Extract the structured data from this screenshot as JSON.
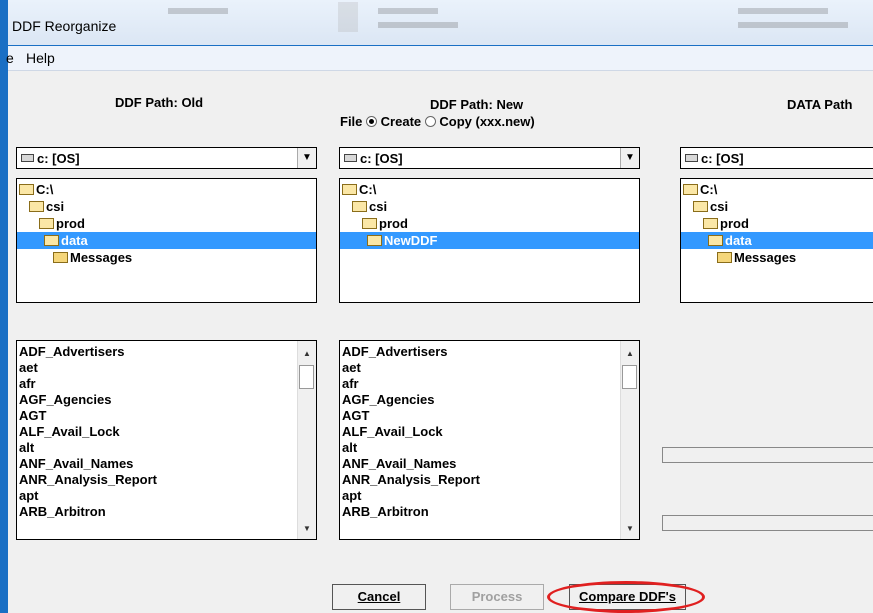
{
  "window": {
    "title": "DDF Reorganize"
  },
  "menu": {
    "items": [
      "e",
      "Help"
    ]
  },
  "columns": {
    "old": {
      "header": "DDF Path: Old",
      "drive": "c: [OS]",
      "tree": [
        "C:\\",
        "csi",
        "prod",
        "data",
        "Messages"
      ],
      "list": [
        "ADF_Advertisers",
        "aet",
        "afr",
        "AGF_Agencies",
        "AGT",
        "ALF_Avail_Lock",
        "alt",
        "ANF_Avail_Names",
        "ANR_Analysis_Report",
        "apt",
        "ARB_Arbitron"
      ]
    },
    "new": {
      "header": "DDF Path: New",
      "file_label": "File",
      "create_label": "Create",
      "copy_label": "Copy (xxx.new)",
      "selected_mode": "Create",
      "drive": "c: [OS]",
      "tree": [
        "C:\\",
        "csi",
        "prod",
        "NewDDF"
      ],
      "list": [
        "ADF_Advertisers",
        "aet",
        "afr",
        "AGF_Agencies",
        "AGT",
        "ALF_Avail_Lock",
        "alt",
        "ANF_Avail_Names",
        "ANR_Analysis_Report",
        "apt",
        "ARB_Arbitron"
      ]
    },
    "data": {
      "header": "DATA Path",
      "drive": "c: [OS]",
      "tree": [
        "C:\\",
        "csi",
        "prod",
        "data",
        "Messages"
      ]
    }
  },
  "buttons": {
    "cancel": "Cancel",
    "process": "Process",
    "compare": "Compare DDF's"
  },
  "colors": {
    "selection": "#3399ff",
    "highlight_ring": "#e02020",
    "window_frame": "#1a6fc4"
  }
}
